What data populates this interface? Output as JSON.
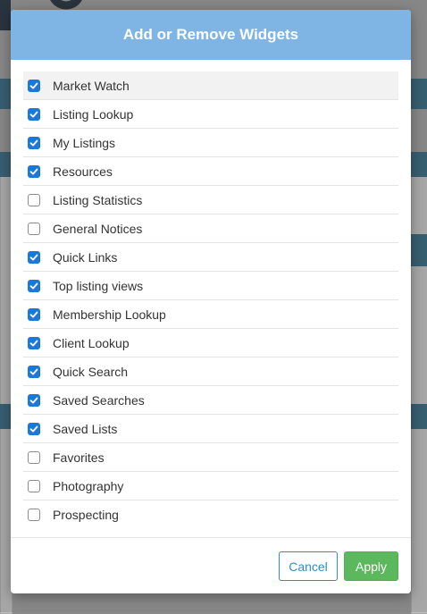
{
  "modal": {
    "title": "Add or Remove Widgets",
    "widgets": [
      {
        "label": "Market Watch",
        "checked": true
      },
      {
        "label": "Listing Lookup",
        "checked": true
      },
      {
        "label": "My Listings",
        "checked": true
      },
      {
        "label": "Resources",
        "checked": true
      },
      {
        "label": "Listing Statistics",
        "checked": false
      },
      {
        "label": "General Notices",
        "checked": false
      },
      {
        "label": "Quick Links",
        "checked": true
      },
      {
        "label": "Top listing views",
        "checked": true
      },
      {
        "label": "Membership Lookup",
        "checked": true
      },
      {
        "label": "Client Lookup",
        "checked": true
      },
      {
        "label": "Quick Search",
        "checked": true
      },
      {
        "label": "Saved Searches",
        "checked": true
      },
      {
        "label": "Saved Lists",
        "checked": true
      },
      {
        "label": "Favorites",
        "checked": false
      },
      {
        "label": "Photography",
        "checked": false
      },
      {
        "label": "Prospecting",
        "checked": false
      }
    ],
    "cancel_label": "Cancel",
    "apply_label": "Apply"
  },
  "colors": {
    "header": "#7fb5e5",
    "checkbox_checked": "#1a78d8",
    "apply_button": "#5cb85c",
    "cancel_button": "#2e8fc2"
  }
}
